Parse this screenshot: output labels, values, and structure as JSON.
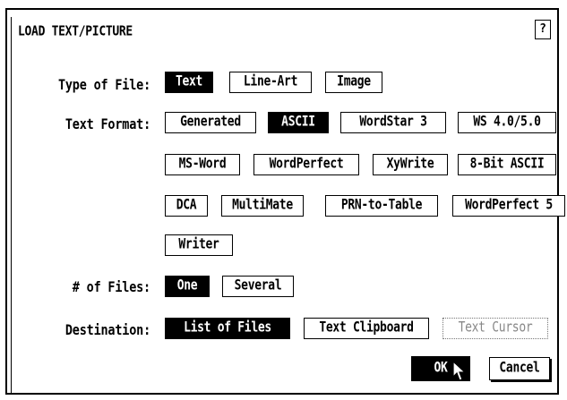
{
  "dialog": {
    "title": "LOAD TEXT/PICTURE",
    "help_label": "?"
  },
  "type_of_file": {
    "label": "Type of File:",
    "options": [
      "Text",
      "Line-Art",
      "Image"
    ],
    "selected": "Text"
  },
  "text_format": {
    "label": "Text Format:",
    "options": [
      "Generated",
      "ASCII",
      "WordStar 3",
      "WS 4.0/5.0",
      "MS-Word",
      "WordPerfect",
      "XyWrite",
      "8-Bit ASCII",
      "DCA",
      "MultiMate",
      "PRN-to-Table",
      "WordPerfect 5",
      "Writer"
    ],
    "selected": "ASCII"
  },
  "num_files": {
    "label": "# of Files:",
    "options": [
      "One",
      "Several"
    ],
    "selected": "One"
  },
  "destination": {
    "label": "Destination:",
    "options": [
      "List of Files",
      "Text Clipboard",
      "Text Cursor"
    ],
    "selected": "List of Files",
    "disabled": [
      "Text Cursor"
    ]
  },
  "actions": {
    "ok_label": "OK",
    "cancel_label": "Cancel"
  }
}
